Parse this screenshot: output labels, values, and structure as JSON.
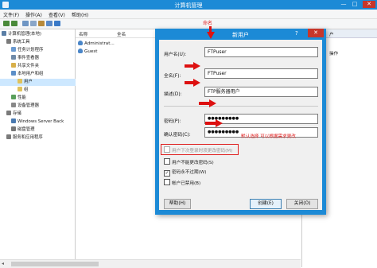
{
  "window": {
    "title": "计算机管理",
    "minimize": "—",
    "maximize": "□",
    "close": "✕"
  },
  "menu": [
    "文件(F)",
    "操作(A)",
    "查看(V)",
    "帮助(H)"
  ],
  "tree": [
    {
      "label": "计算机管理(本地)",
      "indent": 0,
      "icon_color": "#5b7fa6"
    },
    {
      "label": "系统工具",
      "indent": 1,
      "icon_color": "#7a7a7a"
    },
    {
      "label": "任务计划程序",
      "indent": 2,
      "icon_color": "#6a9ad0"
    },
    {
      "label": "事件查看器",
      "indent": 2,
      "icon_color": "#6f8aa8"
    },
    {
      "label": "共享文件夹",
      "indent": 2,
      "icon_color": "#d8b04a"
    },
    {
      "label": "本地用户和组",
      "indent": 2,
      "icon_color": "#5c8fc8"
    },
    {
      "label": "用户",
      "indent": 3,
      "icon_color": "#e0c25c",
      "selected": true
    },
    {
      "label": "组",
      "indent": 3,
      "icon_color": "#e0c25c"
    },
    {
      "label": "性能",
      "indent": 2,
      "icon_color": "#5aa05a"
    },
    {
      "label": "设备管理器",
      "indent": 2,
      "icon_color": "#888888"
    },
    {
      "label": "存储",
      "indent": 1,
      "icon_color": "#7a7a7a"
    },
    {
      "label": "Windows Server Back",
      "indent": 2,
      "icon_color": "#4a7ab0"
    },
    {
      "label": "磁盘管理",
      "indent": 2,
      "icon_color": "#777777"
    },
    {
      "label": "服务和应用程序",
      "indent": 1,
      "icon_color": "#7a7a7a"
    }
  ],
  "list": {
    "col_name": "名称",
    "col_fullname": "全名",
    "rows": [
      "Administrat...",
      "Guest"
    ]
  },
  "actions": {
    "header_suffix": "户",
    "item_suffix": "操作"
  },
  "dialog": {
    "title": "新用户",
    "help_glyph": "?",
    "close_glyph": "✕",
    "username_label": "用户名(U):",
    "username_value": "FTPuser",
    "fullname_label": "全名(F):",
    "fullname_value": "FTPuser",
    "desc_label": "描述(D):",
    "desc_value": "FTP服务器用户",
    "password_label": "密码(P):",
    "password_value": "●●●●●●●●●",
    "confirm_label": "确认密码(C):",
    "confirm_value": "●●●●●●●●●",
    "checkboxes": [
      {
        "label": "用户下次登录时须更改密码(M)",
        "checked": false,
        "disabled": true
      },
      {
        "label": "用户不能更改密码(S)",
        "checked": false,
        "disabled": false
      },
      {
        "label": "密码永不过期(W)",
        "checked": true,
        "disabled": false
      },
      {
        "label": "帐户已禁用(B)",
        "checked": false,
        "disabled": false
      }
    ],
    "help_button": "帮助(H)",
    "create_button": "创建(E)",
    "close_button": "关闭(O)"
  },
  "annotations": {
    "top_note": "命名",
    "side_note": "默认选择 可以根据需求更改"
  },
  "colors": {
    "titlebar": "#1c8ad6",
    "annotation_red": "#e02020",
    "close_red": "#c7362b"
  }
}
